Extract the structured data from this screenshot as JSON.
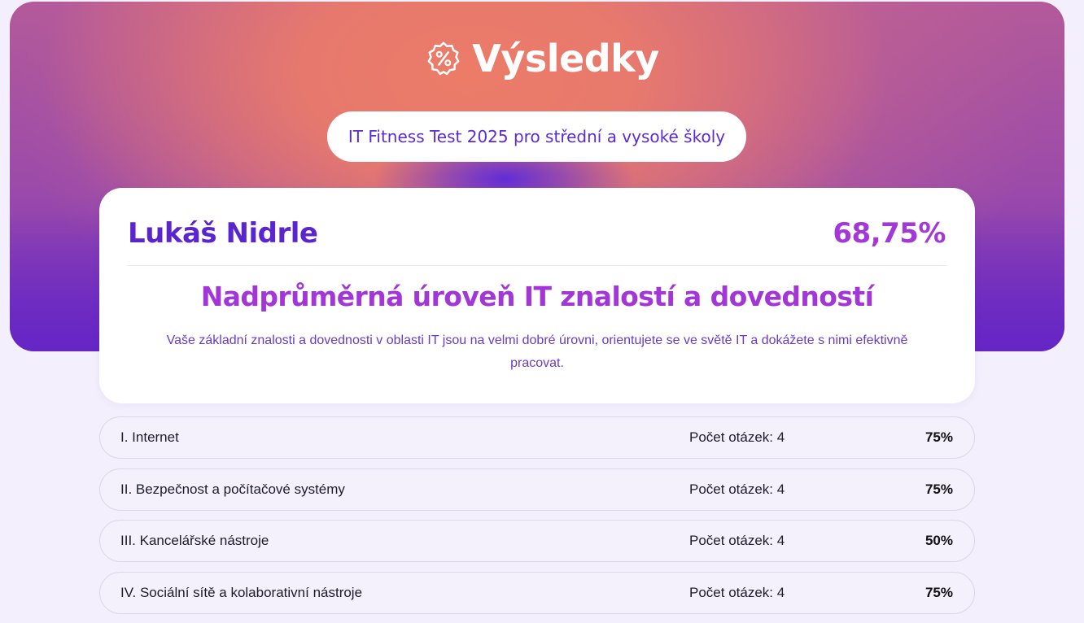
{
  "header": {
    "title": "Výsledky",
    "icon": "percent-badge-icon",
    "subtitle": "IT Fitness Test 2025 pro střední a vysoké školy"
  },
  "result": {
    "name": "Lukáš Nidrle",
    "score": "68,75%",
    "level": "Nadprůměrná úroveň IT znalostí a dovedností",
    "description": "Vaše základní znalosti a dovednosti v oblasti IT jsou na velmi dobré úrovni, orientujete se ve světě IT a dokážete s nimi efektivně pracovat."
  },
  "sections": [
    {
      "label": "I. Internet",
      "count": "Počet otázek: 4",
      "percent": "75%"
    },
    {
      "label": "II. Bezpečnost a počítačové systémy",
      "count": "Počet otázek: 4",
      "percent": "75%"
    },
    {
      "label": "III. Kancelářské nástroje",
      "count": "Počet otázek: 4",
      "percent": "50%"
    },
    {
      "label": "IV. Sociální sítě a kolaborativní nástroje",
      "count": "Počet otázek: 4",
      "percent": "75%"
    }
  ],
  "colors": {
    "accent_purple": "#5a24cf",
    "accent_magenta": "#a236d6",
    "background": "#f3effc"
  }
}
